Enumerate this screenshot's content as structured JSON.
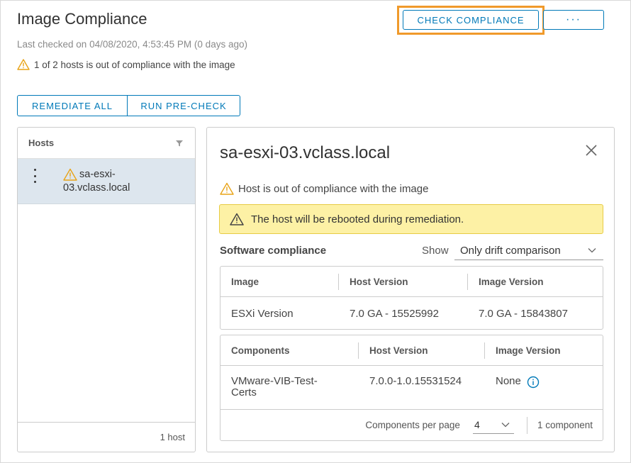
{
  "header": {
    "title": "Image Compliance",
    "last_checked": "Last checked on 04/08/2020, 4:53:45 PM (0 days ago)",
    "summary": "1 of 2 hosts is out of compliance with the image",
    "check_compliance_label": "CHECK COMPLIANCE",
    "more_label": "···",
    "highlight_color": "#f09a2b"
  },
  "actions": {
    "remediate_all": "REMEDIATE ALL",
    "run_precheck": "RUN PRE-CHECK"
  },
  "hosts": {
    "header": "Hosts",
    "items": [
      {
        "name": "sa-esxi-03.vclass.local",
        "status": "warning"
      }
    ],
    "footer": "1 host"
  },
  "detail": {
    "title": "sa-esxi-03.vclass.local",
    "warning": "Host is out of compliance with the image",
    "alert": "The host will be rebooted during remediation.",
    "software_title": "Software compliance",
    "show_label": "Show",
    "show_value": "Only drift comparison",
    "image_table": {
      "headers": [
        "Image",
        "Host Version",
        "Image Version"
      ],
      "rows": [
        [
          "ESXi Version",
          "7.0 GA - 15525992",
          "7.0 GA - 15843807"
        ]
      ]
    },
    "components_table": {
      "headers": [
        "Components",
        "Host Version",
        "Image Version"
      ],
      "rows": [
        [
          "VMware-VIB-Test-Certs",
          "7.0.0-1.0.15531524",
          "None"
        ]
      ]
    },
    "pagination": {
      "per_page_label": "Components per page",
      "per_page_value": "4",
      "count": "1 component"
    }
  },
  "colors": {
    "accent": "#0079b8",
    "warning": "#e8a317",
    "alert_bg": "#fdf1a5",
    "selected_row": "#dde6ee"
  }
}
